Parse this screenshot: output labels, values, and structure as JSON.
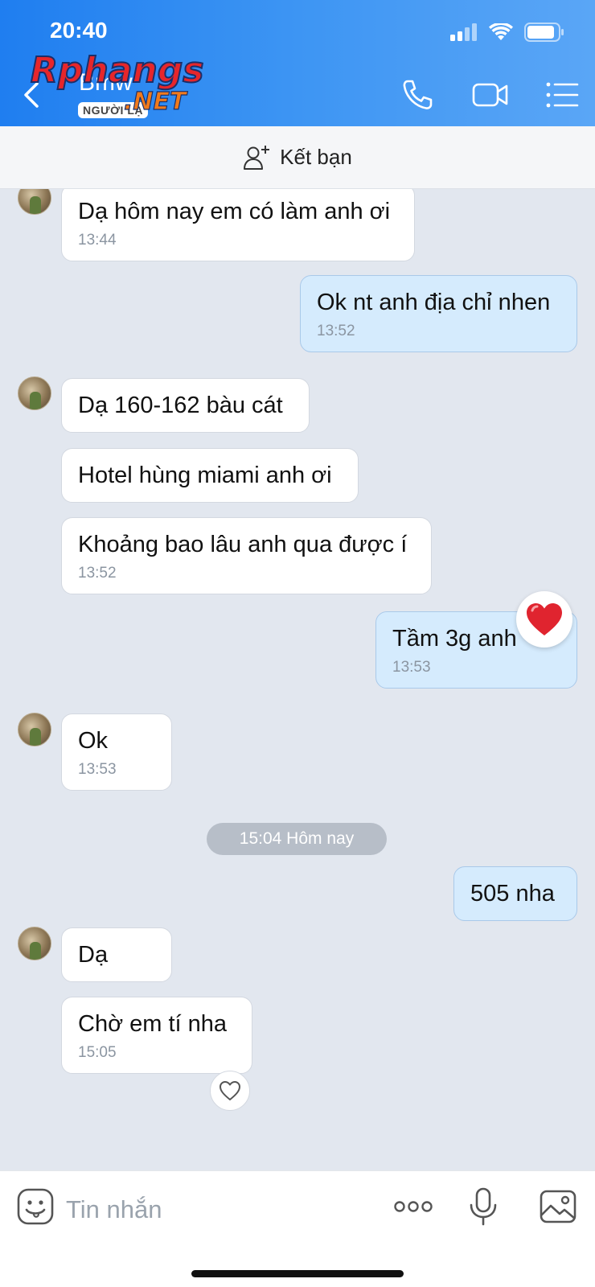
{
  "status": {
    "time": "20:40"
  },
  "header": {
    "title": "Bmw",
    "badge": "NGƯỜI LẠ",
    "watermark_main": "Rphangs",
    "watermark_sub": ".NET"
  },
  "friend_bar": {
    "label": "Kết bạn"
  },
  "messages": [
    {
      "dir": "in",
      "text": "Dạ hôm nay em có làm anh ơi",
      "time": "13:44"
    },
    {
      "dir": "out",
      "text": "Ok nt anh địa chỉ nhen",
      "time": "13:52"
    },
    {
      "dir": "in",
      "text": "Dạ 160-162 bàu cát",
      "time": ""
    },
    {
      "dir": "in",
      "text": "Hotel hùng miami anh ơi",
      "time": ""
    },
    {
      "dir": "in",
      "text": "Khoảng bao lâu anh qua được í",
      "time": "13:52"
    },
    {
      "dir": "out",
      "text": "Tầm 3g anh",
      "time": "13:53"
    },
    {
      "dir": "in",
      "text": "Ok",
      "time": "13:53"
    },
    {
      "dir": "out",
      "text": "505 nha",
      "time": ""
    },
    {
      "dir": "in",
      "text": "Dạ",
      "time": ""
    },
    {
      "dir": "in",
      "text": "Chờ em tí nha",
      "time": "15:05"
    }
  ],
  "date_separator": "15:04 Hôm nay",
  "input": {
    "placeholder": "Tin nhắn",
    "value": ""
  },
  "colors": {
    "header_blue": "#2f8af2",
    "out_bubble": "#d5ebfd",
    "in_bubble": "#ffffff",
    "chat_bg": "#e2e7ef"
  }
}
